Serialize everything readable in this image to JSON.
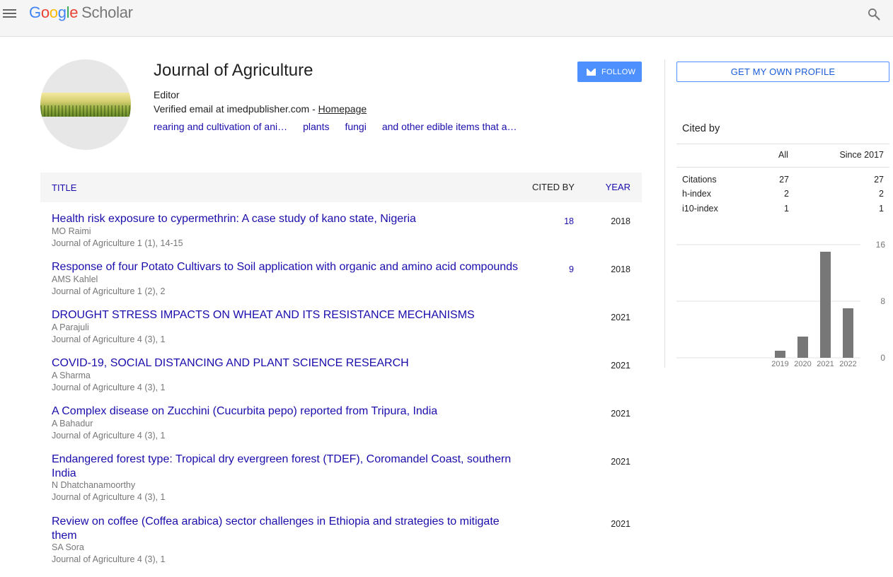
{
  "header": {
    "logo": [
      "G",
      "o",
      "o",
      "g",
      "l",
      "e"
    ],
    "logo_suffix": "Scholar"
  },
  "profile": {
    "name": "Journal of Agriculture",
    "affiliation": "Editor",
    "email_text": "Verified email at imedpublisher.com - ",
    "homepage_label": "Homepage",
    "interests": [
      "rearing and cultivation of ani…",
      "plants",
      "fungi",
      "and other edible items that a…"
    ],
    "follow_label": "FOLLOW"
  },
  "table": {
    "col_title": "TITLE",
    "col_cited": "CITED BY",
    "col_year": "YEAR",
    "rows": [
      {
        "title": "Health risk exposure to cypermethrin: A case study of kano state, Nigeria",
        "authors": "MO Raimi",
        "venue": "Journal of Agriculture 1 (1), 14-15",
        "cited": "18",
        "year": "2018"
      },
      {
        "title": "Response of four Potato Cultivars to Soil application with organic and amino acid compounds",
        "authors": "AMS Kahlel",
        "venue": "Journal of Agriculture 1 (2), 2",
        "cited": "9",
        "year": "2018"
      },
      {
        "title": "DROUGHT STRESS IMPACTS ON WHEAT AND ITS RESISTANCE MECHANISMS",
        "authors": "A Parajuli",
        "venue": "Journal of Agriculture 4 (3), 1",
        "cited": "",
        "year": "2021"
      },
      {
        "title": "COVID-19, SOCIAL DISTANCING AND PLANT SCIENCE RESEARCH",
        "authors": "A Sharma",
        "venue": "Journal of Agriculture 4 (3), 1",
        "cited": "",
        "year": "2021"
      },
      {
        "title": "A Complex disease on Zucchini (Cucurbita pepo) reported from Tripura, India",
        "authors": "A Bahadur",
        "venue": "Journal of Agriculture 4 (3), 1",
        "cited": "",
        "year": "2021"
      },
      {
        "title": "Endangered forest type: Tropical dry evergreen forest (TDEF), Coromandel Coast, southern India",
        "authors": "N Dhatchanamoorthy",
        "venue": "Journal of Agriculture 4 (3), 1",
        "cited": "",
        "year": "2021"
      },
      {
        "title": "Review on coffee (Coffea arabica) sector challenges in Ethiopia and strategies to mitigate them",
        "authors": "SA Sora",
        "venue": "Journal of Agriculture 4 (3), 1",
        "cited": "",
        "year": "2021"
      }
    ]
  },
  "sidebar": {
    "own_profile_label": "GET MY OWN PROFILE",
    "cited_by_heading": "Cited by",
    "col_all": "All",
    "col_since": "Since 2017",
    "metrics": [
      {
        "label": "Citations",
        "all": "27",
        "since": "27"
      },
      {
        "label": "h-index",
        "all": "2",
        "since": "2"
      },
      {
        "label": "i10-index",
        "all": "1",
        "since": "1"
      }
    ]
  },
  "chart_data": {
    "type": "bar",
    "categories": [
      "2019",
      "2020",
      "2021",
      "2022"
    ],
    "values": [
      1,
      3,
      15,
      7
    ],
    "ylim": [
      0,
      16
    ],
    "yticks": [
      "0",
      "8",
      "16"
    ],
    "bar_color": "#777777",
    "grid": true,
    "title": "",
    "xlabel": "",
    "ylabel": ""
  }
}
